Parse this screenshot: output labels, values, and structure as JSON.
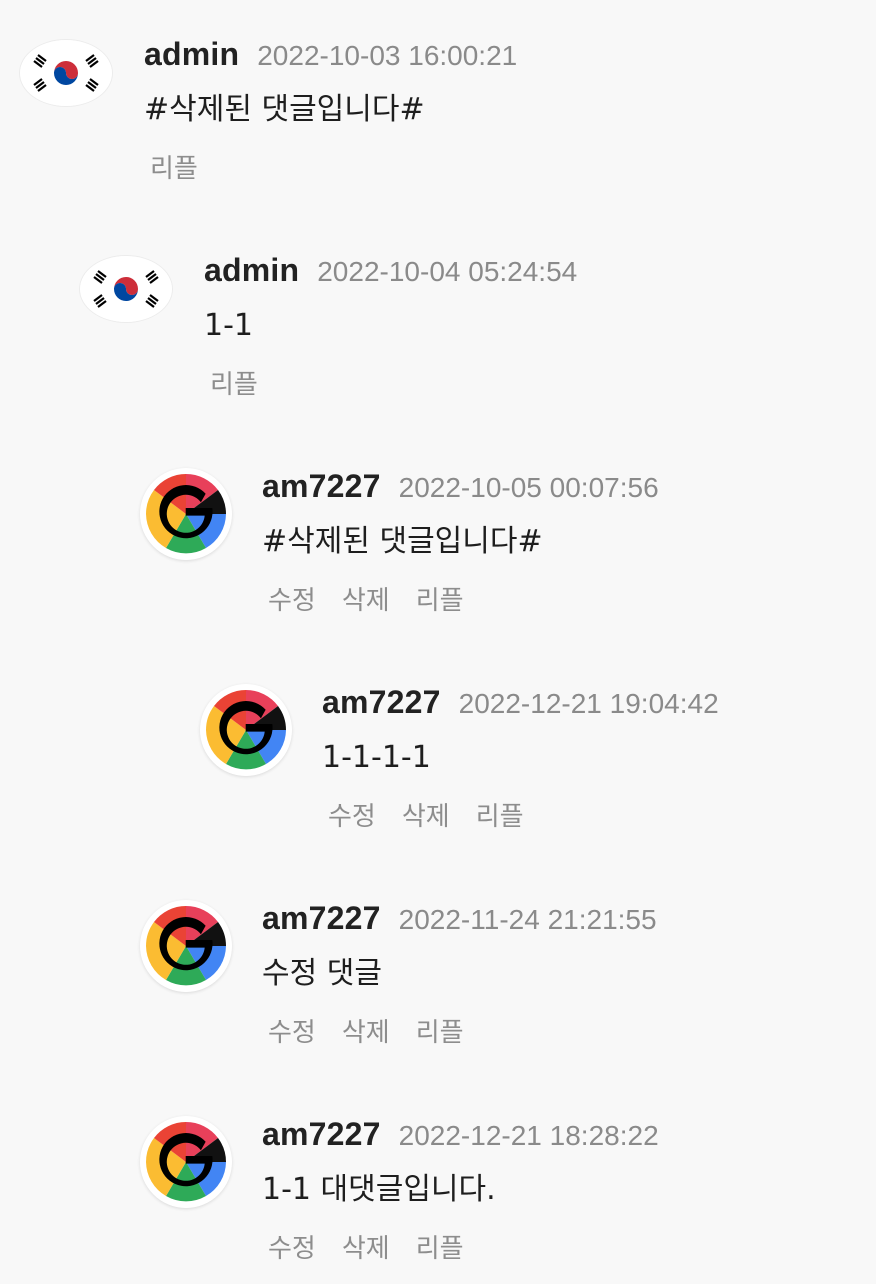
{
  "comments": [
    {
      "author": "admin",
      "date": "2022-10-03 16:00:21",
      "text": "#삭제된 댓글입니다#",
      "avatar": "korea-flag-icon",
      "actions": {
        "reply": "리플"
      }
    },
    {
      "author": "admin",
      "date": "2022-10-04 05:24:54",
      "text": "1-1",
      "avatar": "korea-flag-icon",
      "actions": {
        "reply": "리플"
      }
    },
    {
      "author": "am7227",
      "date": "2022-10-05 00:07:56",
      "text": "#삭제된 댓글입니다#",
      "avatar": "google-icon",
      "actions": {
        "edit": "수정",
        "delete": "삭제",
        "reply": "리플"
      }
    },
    {
      "author": "am7227",
      "date": "2022-12-21 19:04:42",
      "text": "1-1-1-1",
      "avatar": "google-icon",
      "actions": {
        "edit": "수정",
        "delete": "삭제",
        "reply": "리플"
      }
    },
    {
      "author": "am7227",
      "date": "2022-11-24 21:21:55",
      "text": "수정 댓글",
      "avatar": "google-icon",
      "actions": {
        "edit": "수정",
        "delete": "삭제",
        "reply": "리플"
      }
    },
    {
      "author": "am7227",
      "date": "2022-12-21 18:28:22",
      "text": "1-1 대댓글입니다.",
      "avatar": "google-icon",
      "actions": {
        "edit": "수정",
        "delete": "삭제",
        "reply": "리플"
      }
    }
  ],
  "colors": {
    "background": "#f8f8f8",
    "author": "#222222",
    "date": "#8a8a8a",
    "action": "#8d8d8d"
  }
}
